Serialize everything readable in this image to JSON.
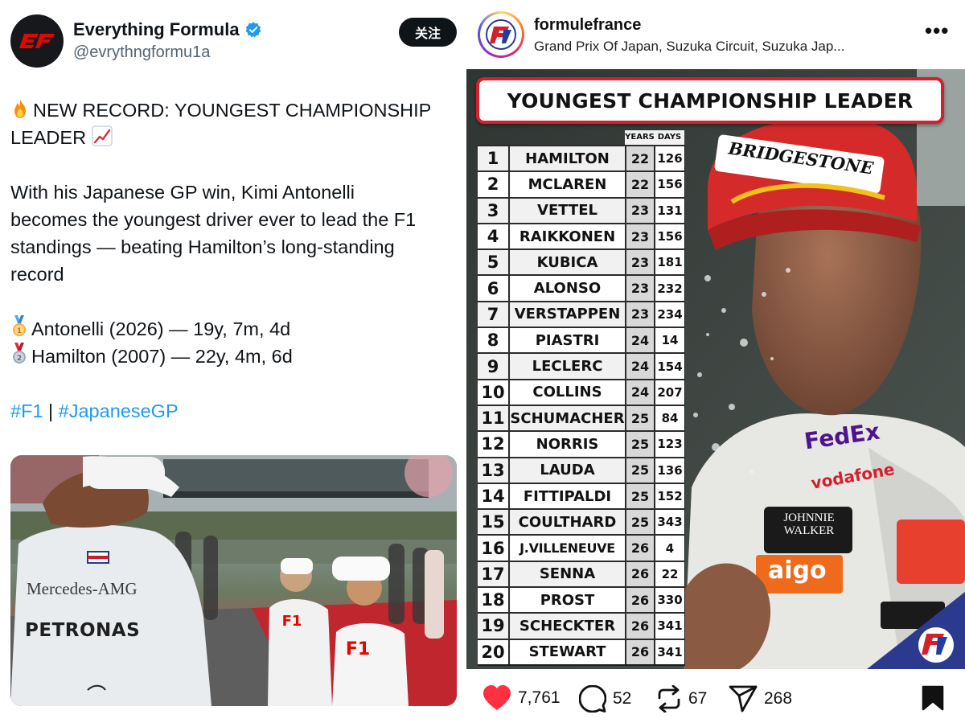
{
  "tweet": {
    "display_name": "Everything Formula",
    "handle": "@evrythngformu1a",
    "follow_label": "关注",
    "headline_line1": "NEW RECORD: YOUNGEST CHAMPIONSHIP",
    "headline_line2": "LEADER",
    "para_line1": "With his Japanese GP win, Kimi Antonelli",
    "para_line2": "becomes the youngest driver ever to lead the F1",
    "para_line3": "standings — beating Hamilton’s long-standing",
    "para_line4": "record",
    "stat1": "Antonelli (2026) — 19y, 7m, 4d",
    "stat2": "Hamilton (2007) — 22y, 4m, 6d",
    "tag1": "#F1",
    "tag_sep": " | ",
    "tag2": "#JapaneseGP",
    "photo_text": {
      "mercedes": "Mercedes-AMG",
      "petronas": "PETRONAS"
    }
  },
  "instagram": {
    "username": "formulefrance",
    "location": "Grand Prix Of Japan, Suzuka Circuit, Suzuka Jap...",
    "more_label": "•••",
    "banner_title": "YOUNGEST CHAMPIONSHIP LEADER",
    "col_years": "YEARS",
    "col_days": "DAYS",
    "rows": [
      {
        "rank": "1",
        "name": "HAMILTON",
        "years": "22",
        "days": "126"
      },
      {
        "rank": "2",
        "name": "MCLAREN",
        "years": "22",
        "days": "156"
      },
      {
        "rank": "3",
        "name": "VETTEL",
        "years": "23",
        "days": "131"
      },
      {
        "rank": "4",
        "name": "RAIKKONEN",
        "years": "23",
        "days": "156"
      },
      {
        "rank": "5",
        "name": "KUBICA",
        "years": "23",
        "days": "181"
      },
      {
        "rank": "6",
        "name": "ALONSO",
        "years": "23",
        "days": "232"
      },
      {
        "rank": "7",
        "name": "VERSTAPPEN",
        "years": "23",
        "days": "234"
      },
      {
        "rank": "8",
        "name": "PIASTRI",
        "years": "24",
        "days": "14"
      },
      {
        "rank": "9",
        "name": "LECLERC",
        "years": "24",
        "days": "154"
      },
      {
        "rank": "10",
        "name": "COLLINS",
        "years": "24",
        "days": "207"
      },
      {
        "rank": "11",
        "name": "SCHUMACHER",
        "years": "25",
        "days": "84"
      },
      {
        "rank": "12",
        "name": "NORRIS",
        "years": "25",
        "days": "123"
      },
      {
        "rank": "13",
        "name": "LAUDA",
        "years": "25",
        "days": "136"
      },
      {
        "rank": "14",
        "name": "FITTIPALDI",
        "years": "25",
        "days": "152"
      },
      {
        "rank": "15",
        "name": "COULTHARD",
        "years": "25",
        "days": "343"
      },
      {
        "rank": "16",
        "name": "J.VILLENEUVE",
        "years": "26",
        "days": "4"
      },
      {
        "rank": "17",
        "name": "SENNA",
        "years": "26",
        "days": "22"
      },
      {
        "rank": "18",
        "name": "PROST",
        "years": "26",
        "days": "330"
      },
      {
        "rank": "19",
        "name": "SCHECKTER",
        "years": "26",
        "days": "341"
      },
      {
        "rank": "20",
        "name": "STEWART",
        "years": "26",
        "days": "341"
      }
    ],
    "photo_text": {
      "cap": "BRIDGESTONE",
      "fedex": "FedEx",
      "vodafone": "vodafone",
      "johnnie": "JOHNNIE WALKER",
      "aigo": "aigo"
    },
    "likes": "7,761",
    "comments": "52",
    "reposts": "67",
    "shares": "268"
  },
  "colors": {
    "accent_red": "#d4202b",
    "like_red": "#ff3040",
    "link_blue": "#1d9bf0",
    "verified_blue": "#1d9bf0"
  }
}
